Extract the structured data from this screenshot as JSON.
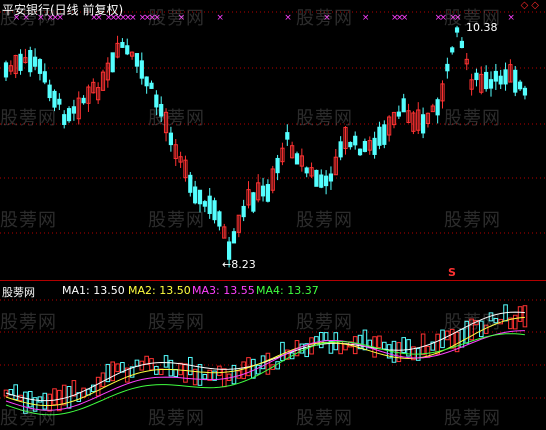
{
  "title": "平安银行(日线 前复权)",
  "header_marker": "◇◇",
  "price_high_label": "10.38",
  "price_low_label": "8.23",
  "sub_marker": "S",
  "indicator_name": "股蒡网",
  "ma_lines": [
    {
      "label": "MA1:",
      "value": "13.50",
      "color": "#ffffff"
    },
    {
      "label": "MA2:",
      "value": "13.50",
      "color": "#ffff40"
    },
    {
      "label": "MA3:",
      "value": "13.55",
      "color": "#ff40ff"
    },
    {
      "label": "MA4:",
      "value": "13.37",
      "color": "#40ff40"
    }
  ],
  "watermark": "股蒡网",
  "colors": {
    "up": "#ff3232",
    "down": "#54ffff",
    "grid": "#b30000",
    "signal": "#ff40ff",
    "ma_yellow": "#ffff40",
    "ma_magenta": "#ff40ff",
    "ma_green": "#40ff40",
    "ma_white": "#ffffff"
  }
}
